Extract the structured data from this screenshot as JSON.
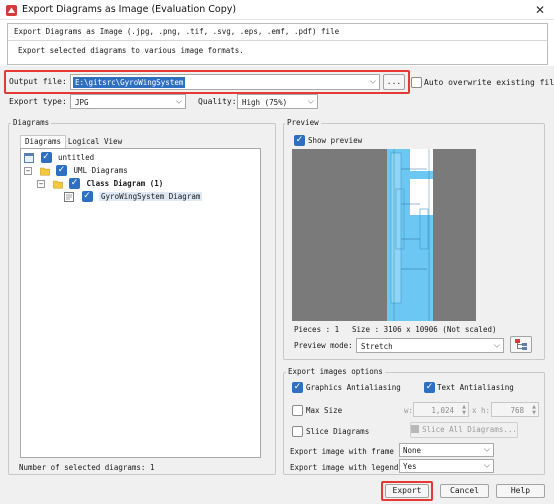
{
  "window": {
    "title": "Export Diagrams as Image (Evaluation Copy)",
    "close_glyph": "✕"
  },
  "banner": {
    "heading": "Export Diagrams as Image (.jpg, .png, .tif, .svg, .eps, .emf, .pdf) file",
    "description": "Export selected diagrams to various image formats."
  },
  "output": {
    "label": "Output file:",
    "value": "E:\\gitsrc\\GyroWingSystem",
    "browse_label": "...",
    "overwrite_label": "Auto overwrite existing files",
    "overwrite_checked": false
  },
  "export_type": {
    "label": "Export type:",
    "value": "JPG"
  },
  "quality": {
    "label": "Quality:",
    "value": "High (75%)"
  },
  "diagrams": {
    "group_title": "Diagrams",
    "tabs": [
      "Diagrams",
      "Logical View"
    ],
    "tree": [
      {
        "label": "untitled",
        "level": 0,
        "checked": true
      },
      {
        "label": "UML Diagrams",
        "level": 1,
        "checked": true
      },
      {
        "label": "Class Diagram (1)",
        "level": 2,
        "checked": true
      },
      {
        "label": "GyroWingSystem Diagram",
        "level": 3,
        "checked": true
      }
    ],
    "count_text": "Number of selected diagrams: 1"
  },
  "preview": {
    "group_title": "Preview",
    "show_preview_label": "Show preview",
    "show_preview_checked": true,
    "pieces_text": "Pieces : 1",
    "size_text": "Size : 3106 x 10906 (Not scaled)",
    "mode_label": "Preview mode:",
    "mode_value": "Stretch"
  },
  "options": {
    "group_title": "Export images options",
    "graphics_aa_label": "Graphics Antialiasing",
    "graphics_aa_checked": true,
    "text_aa_label": "Text Antialiasing",
    "text_aa_checked": true,
    "max_size_label": "Max  Size",
    "max_size_checked": false,
    "w_label": "w:",
    "w_value": "1,024",
    "h_label": "x h:",
    "h_value": "768",
    "slice_label": "Slice Diagrams",
    "slice_checked": false,
    "slice_all_label": "Slice All Diagrams...",
    "frame_label": "Export image with frame :",
    "frame_value": "None",
    "legend_label": "Export image with legend :",
    "legend_value": "Yes"
  },
  "buttons": {
    "export": "Export",
    "cancel": "Cancel",
    "help": "Help"
  },
  "colors": {
    "accent": "#2f6fc0",
    "highlight_red": "#e53935",
    "diagram_blue": "#6cc7f2"
  }
}
